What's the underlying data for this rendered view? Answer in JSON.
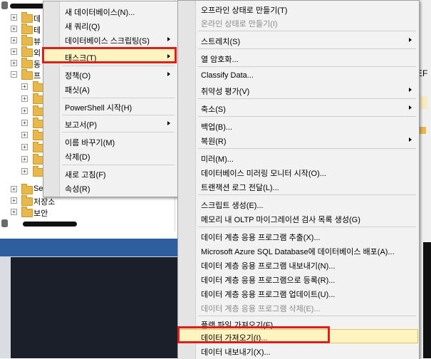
{
  "tree": {
    "items": [
      {
        "label": "데"
      },
      {
        "label": "테"
      },
      {
        "label": "뷰"
      },
      {
        "label": "외"
      },
      {
        "label": "동"
      },
      {
        "label": "프"
      },
      {
        "label": "Se"
      },
      {
        "label": "저장소"
      },
      {
        "label": "보안"
      }
    ]
  },
  "right_fragment": "EF",
  "context_menu": {
    "items": [
      {
        "label": "새 데이터베이스(N)..."
      },
      {
        "label": "새 쿼리(Q)"
      },
      {
        "label": "데이터베이스 스크립팅(S)"
      },
      {
        "label": "태스크(T)"
      },
      {
        "label": "정책(O)"
      },
      {
        "label": "패싯(A)"
      },
      {
        "label": "PowerShell 시작(H)"
      },
      {
        "label": "보고서(P)"
      },
      {
        "label": "이름 바꾸기(M)"
      },
      {
        "label": "삭제(D)"
      },
      {
        "label": "새로 고침(F)"
      },
      {
        "label": "속성(R)"
      }
    ]
  },
  "tasks_menu": {
    "items": [
      {
        "label": "오프라인 상태로 만들기(T)"
      },
      {
        "label": "온라인 상태로 만들기(I)"
      },
      {
        "label": "스트레치(S)"
      },
      {
        "label": "열 암호화..."
      },
      {
        "label": "Classify Data..."
      },
      {
        "label": "취약성 평가(V)"
      },
      {
        "label": "축소(S)"
      },
      {
        "label": "백업(B)..."
      },
      {
        "label": "복원(R)"
      },
      {
        "label": "미러(M)..."
      },
      {
        "label": "데이터베이스 미러링 모니터 시작(O)..."
      },
      {
        "label": "트랜잭션 로그 전달(L)..."
      },
      {
        "label": "스크립트 생성(E)..."
      },
      {
        "label": "메모리 내 OLTP 마이그레이션 검사 목록 생성(G)"
      },
      {
        "label": "데이터 계층 응용 프로그램 추출(X)..."
      },
      {
        "label": "Microsoft Azure SQL Database에 데이터베이스 배포(A)..."
      },
      {
        "label": "데이터 계층 응용 프로그램 내보내기(N)..."
      },
      {
        "label": "데이터 계층 응용 프로그램으로 등록(R)..."
      },
      {
        "label": "데이터 계층 응용 프로그램 업데이트(U)..."
      },
      {
        "label": "데이터 계층 응용 프로그램 삭제(E)..."
      },
      {
        "label": "플랫 파일 가져오기(F)..."
      },
      {
        "label": "데이터 가져오기(I)..."
      },
      {
        "label": "데이터 내보내기(X)..."
      }
    ]
  }
}
